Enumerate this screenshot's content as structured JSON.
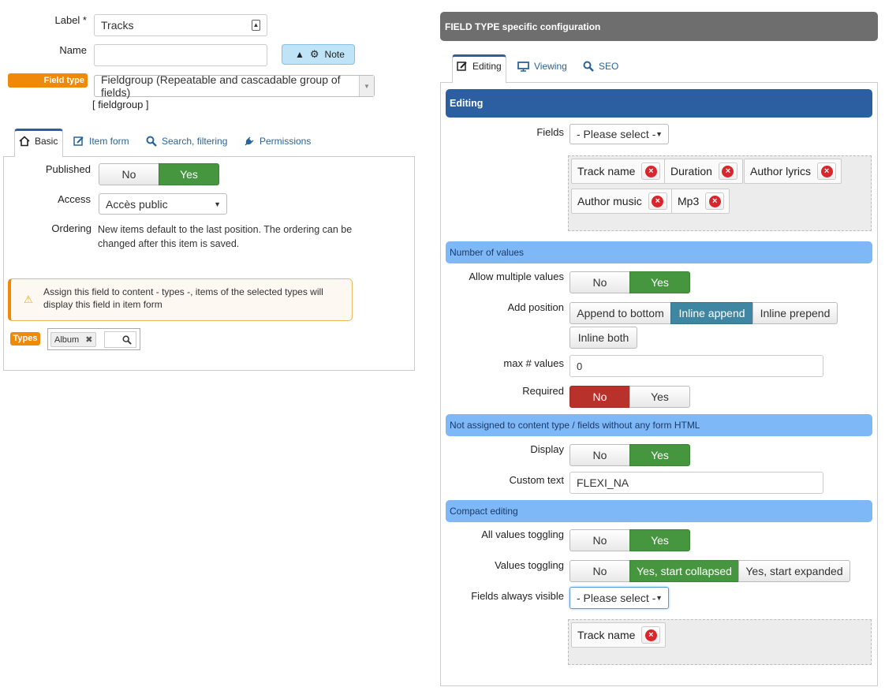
{
  "left": {
    "label_label": "Label *",
    "label_value": "Tracks",
    "name_label": "Name",
    "name_value": "",
    "note_button": "Note",
    "field_type_badge": "Field type",
    "field_type_value": "Fieldgroup (Repeatable and cascadable group of fields)",
    "field_type_code": "[ fieldgroup ]",
    "tabs": [
      {
        "label": "Basic",
        "icon": "home-icon"
      },
      {
        "label": "Item form",
        "icon": "edit-icon"
      },
      {
        "label": "Search, filtering",
        "icon": "search-icon"
      },
      {
        "label": "Permissions",
        "icon": "plug-icon"
      }
    ],
    "published_label": "Published",
    "published_no": "No",
    "published_yes": "Yes",
    "access_label": "Access",
    "access_value": "Accès public",
    "ordering_label": "Ordering",
    "ordering_text": "New items default to the last position. The ordering can be changed after this item is saved.",
    "warning_text": "Assign this field to content - types -, items of the selected types will display this field in item form",
    "types_badge": "Types",
    "types_chip": "Album"
  },
  "right": {
    "header": "FIELD TYPE specific configuration",
    "tabs": [
      {
        "label": "Editing",
        "icon": "edit-icon"
      },
      {
        "label": "Viewing",
        "icon": "monitor-icon"
      },
      {
        "label": "SEO",
        "icon": "search-icon"
      }
    ],
    "editing_header": "Editing",
    "fields_label": "Fields",
    "fields_select": "- Please select -",
    "fields_tags": [
      "Track name",
      "Duration",
      "Author lyrics",
      "Author music",
      "Mp3"
    ],
    "section_number": "Number of values",
    "allow_multiple_label": "Allow multiple values",
    "allow_multiple_no": "No",
    "allow_multiple_yes": "Yes",
    "add_position_label": "Add position",
    "add_position_options": [
      "Append to bottom",
      "Inline append",
      "Inline prepend",
      "Inline both"
    ],
    "max_values_label": "max # values",
    "max_values_value": "0",
    "required_label": "Required",
    "required_no": "No",
    "required_yes": "Yes",
    "section_not_assigned": "Not assigned to content type / fields without any form HTML",
    "display_label": "Display",
    "display_no": "No",
    "display_yes": "Yes",
    "custom_text_label": "Custom text",
    "custom_text_value": "FLEXI_NA",
    "section_compact": "Compact editing",
    "all_toggling_label": "All values toggling",
    "all_toggling_no": "No",
    "all_toggling_yes": "Yes",
    "values_toggling_label": "Values toggling",
    "values_toggling_options": [
      "No",
      "Yes, start collapsed",
      "Yes, start expanded"
    ],
    "always_visible_label": "Fields always visible",
    "always_visible_select": "- Please select -",
    "always_visible_tags": [
      "Track name"
    ]
  },
  "colors": {
    "green": "#46963f",
    "red": "#b8322b",
    "teal": "#3f86a3",
    "orange_badge": "#f0890a",
    "editing_header": "#2b5fa1",
    "section_header": "#7fb8f7",
    "top_header": "#6e6e6e"
  }
}
